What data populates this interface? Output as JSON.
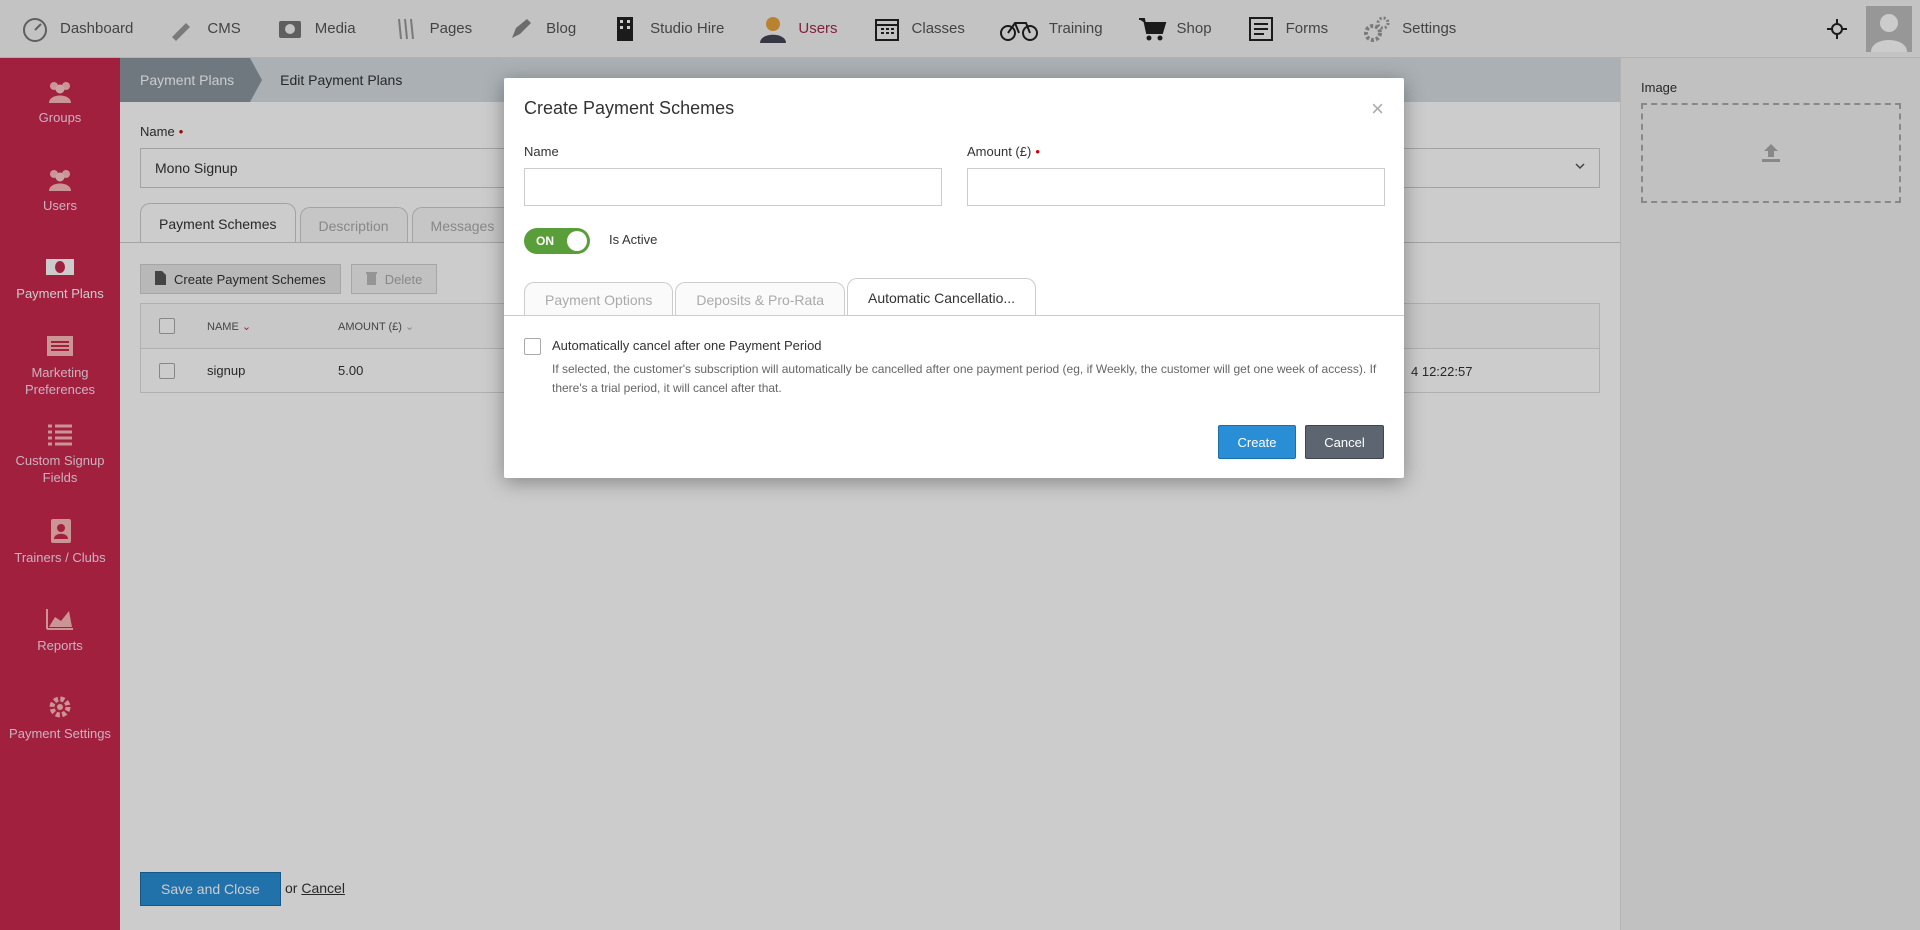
{
  "topnav": {
    "items": [
      {
        "label": "Dashboard",
        "icon": "dashboard-icon"
      },
      {
        "label": "CMS",
        "icon": "cms-icon"
      },
      {
        "label": "Media",
        "icon": "media-icon"
      },
      {
        "label": "Pages",
        "icon": "pages-icon"
      },
      {
        "label": "Blog",
        "icon": "blog-icon"
      },
      {
        "label": "Studio Hire",
        "icon": "building-icon"
      },
      {
        "label": "Users",
        "icon": "user-icon"
      },
      {
        "label": "Classes",
        "icon": "calendar-icon"
      },
      {
        "label": "Training",
        "icon": "bicycle-icon"
      },
      {
        "label": "Shop",
        "icon": "cart-icon"
      },
      {
        "label": "Forms",
        "icon": "form-icon"
      },
      {
        "label": "Settings",
        "icon": "gear-icon"
      }
    ],
    "active": "Users"
  },
  "sidebar": {
    "items": [
      {
        "label": "Groups"
      },
      {
        "label": "Users"
      },
      {
        "label": "Payment Plans"
      },
      {
        "label": "Marketing Preferences"
      },
      {
        "label": "Custom Signup Fields"
      },
      {
        "label": "Trainers / Clubs"
      },
      {
        "label": "Reports"
      },
      {
        "label": "Payment Settings"
      }
    ]
  },
  "breadcrumb": {
    "parent": "Payment Plans",
    "current": "Edit Payment Plans"
  },
  "form": {
    "name_label": "Name",
    "name_value": "Mono Signup"
  },
  "tabs": [
    "Payment Schemes",
    "Description",
    "Messages"
  ],
  "toolbar": {
    "create_label": "Create Payment Schemes",
    "delete_label": "Delete"
  },
  "table": {
    "headers": {
      "name": "NAME",
      "amount": "AMOUNT (£)"
    },
    "rows": [
      {
        "name": "signup",
        "amount": "5.00",
        "date": "4 12:22:57"
      }
    ]
  },
  "footer": {
    "save_label": "Save and Close",
    "or": "or",
    "cancel_label": "Cancel"
  },
  "right_panel": {
    "image_label": "Image"
  },
  "modal": {
    "title": "Create Payment Schemes",
    "close": "×",
    "name_label": "Name",
    "amount_label": "Amount (£)",
    "toggle_text": "ON",
    "toggle_label": "Is Active",
    "tabs": [
      "Payment Options",
      "Deposits & Pro-Rata",
      "Automatic Cancellatio..."
    ],
    "checkbox_label": "Automatically cancel after one Payment Period",
    "help_text": "If selected, the customer's subscription will automatically be cancelled after one payment period (eg, if Weekly, the customer will get one week of access). If there's a trial period, it will cancel after that.",
    "create_label": "Create",
    "cancel_label": "Cancel"
  },
  "colors": {
    "sidebar": "#c9284e",
    "primary": "#2a8ed6",
    "toggle": "#5a9e3a",
    "active_nav": "#a52a4a"
  }
}
